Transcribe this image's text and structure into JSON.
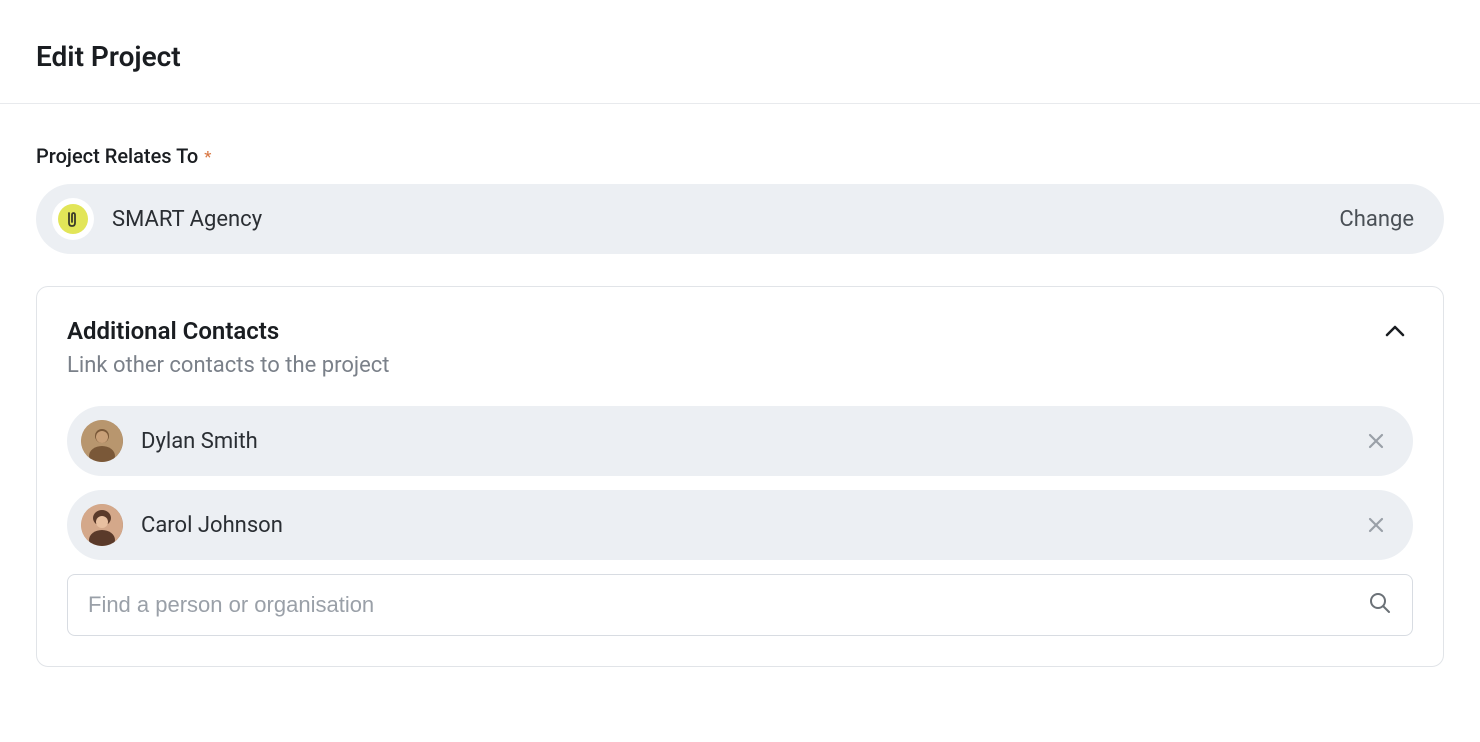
{
  "header": {
    "title": "Edit Project"
  },
  "relatesTo": {
    "label": "Project Relates To",
    "required": "*",
    "orgName": "SMART Agency",
    "changeLabel": "Change"
  },
  "additionalContacts": {
    "title": "Additional Contacts",
    "subtitle": "Link other contacts to the project",
    "contacts": [
      {
        "name": "Dylan Smith"
      },
      {
        "name": "Carol Johnson"
      }
    ],
    "searchPlaceholder": "Find a person or organisation"
  }
}
